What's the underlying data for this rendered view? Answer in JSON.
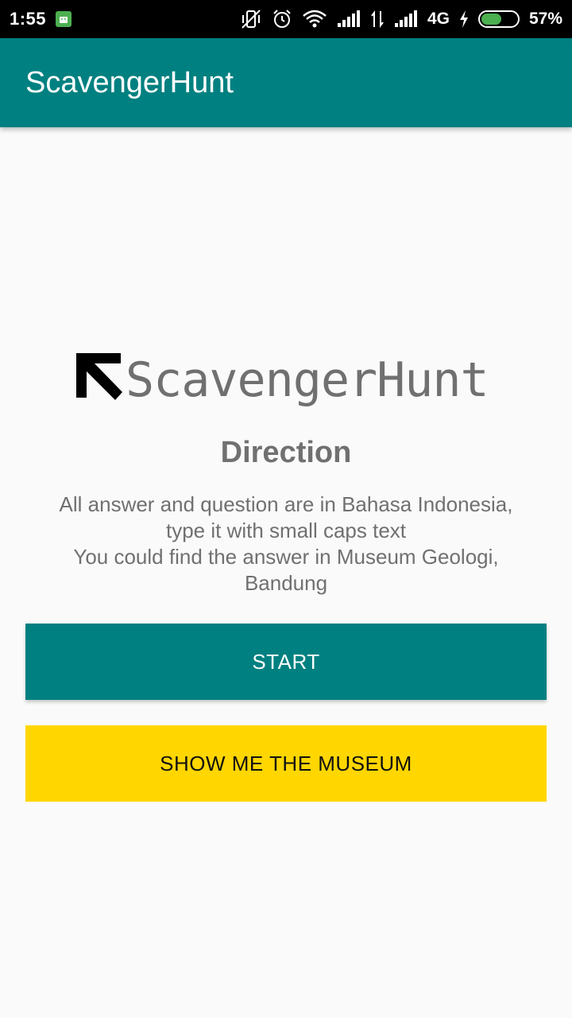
{
  "status_bar": {
    "time": "1:55",
    "network": "4G",
    "battery_percent": "57%",
    "battery_level": 0.57,
    "icons": [
      "android-icon",
      "vibrate-off-icon",
      "alarm-icon",
      "wifi-icon",
      "signal-icon",
      "data-arrows-icon",
      "signal-icon",
      "charging-icon",
      "battery-icon"
    ]
  },
  "app_bar": {
    "title": "ScavengerHunt"
  },
  "logo": {
    "text": "ScavengerHunt",
    "icon": "arrow-up-left-icon"
  },
  "direction": {
    "title": "Direction",
    "lines": [
      "All answer and question are in Bahasa Indonesia,",
      "type it with small caps text",
      "You could find the answer in Museum Geologi,",
      "Bandung"
    ]
  },
  "buttons": {
    "start_label": "START",
    "museum_label": "SHOW ME THE MUSEUM"
  },
  "colors": {
    "primary": "#008080",
    "accent": "#ffd600",
    "text_gray": "#707070",
    "background": "#fafafa"
  }
}
